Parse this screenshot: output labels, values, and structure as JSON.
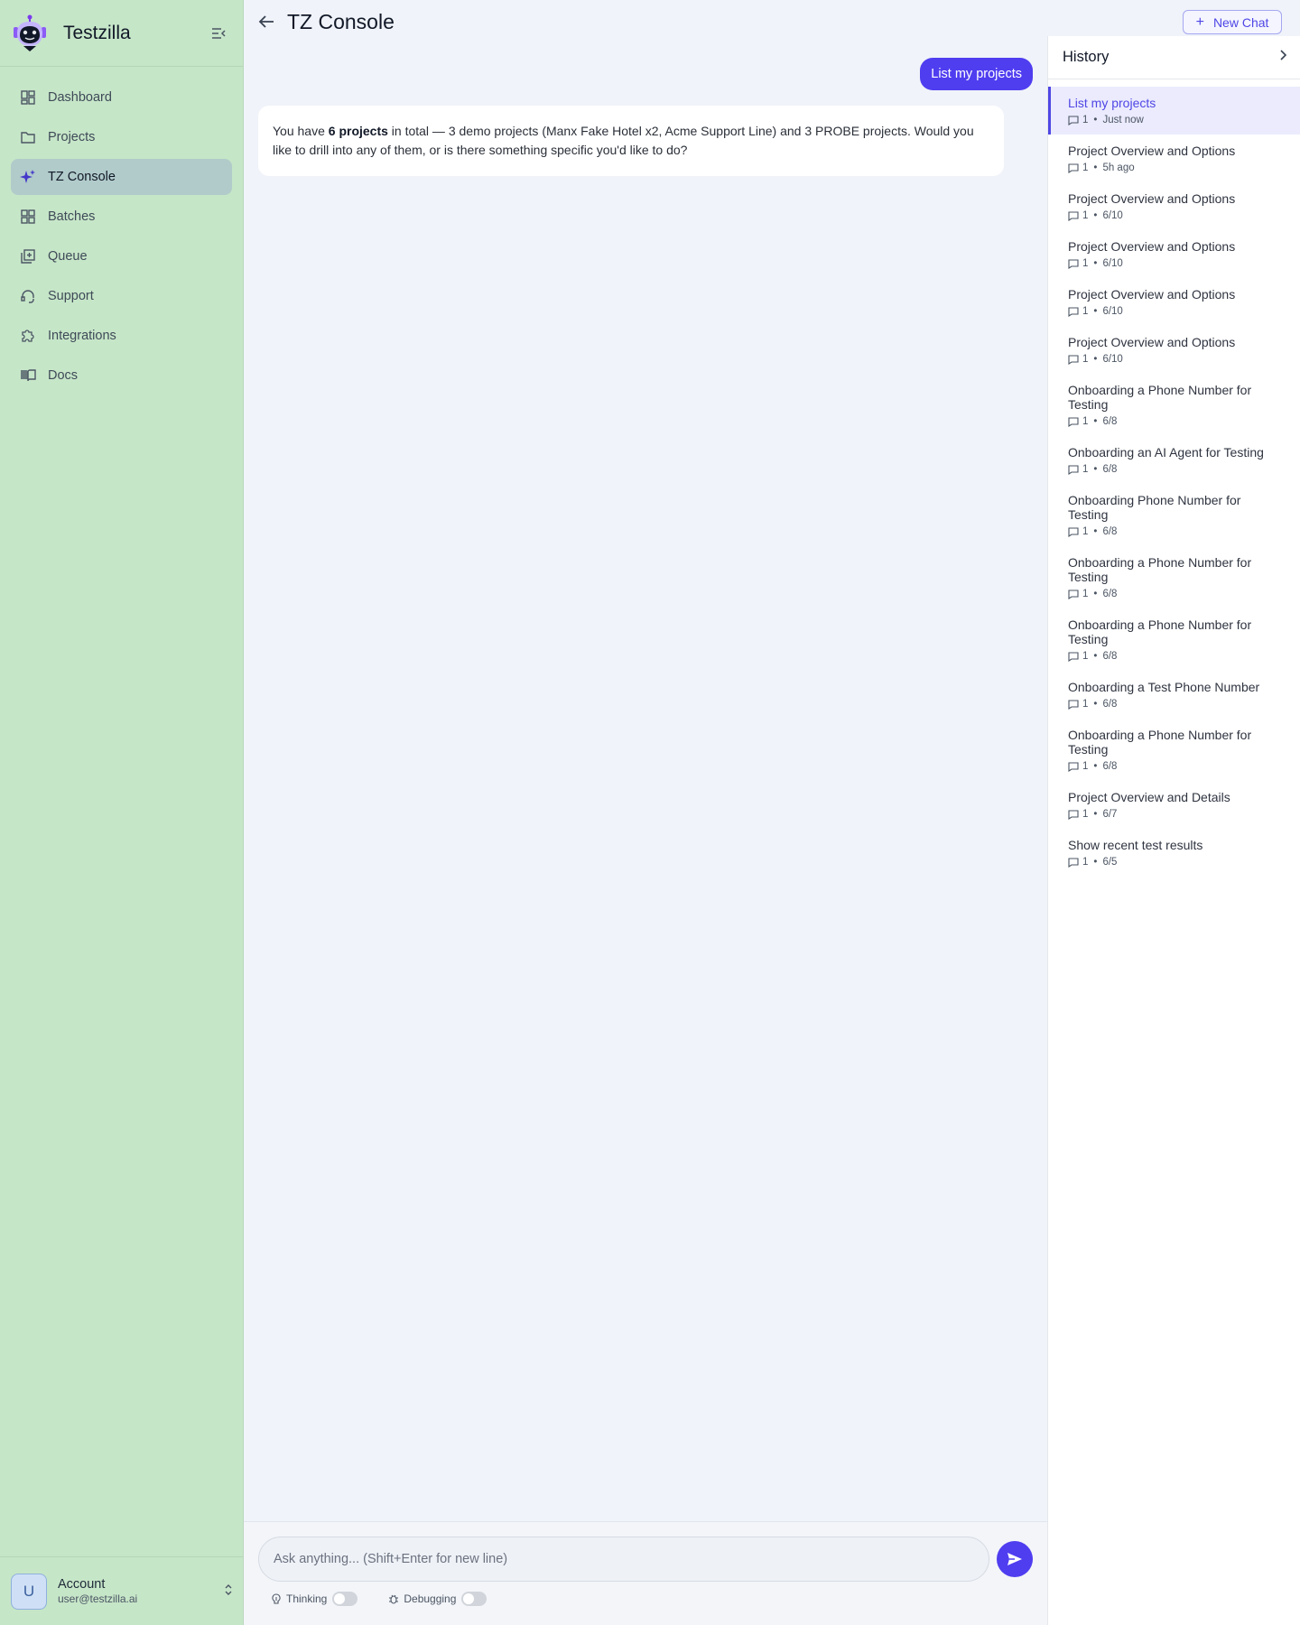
{
  "sidebar": {
    "brand": "Testzilla",
    "items": [
      {
        "label": "Dashboard",
        "icon": "dashboard-icon"
      },
      {
        "label": "Projects",
        "icon": "folder-icon"
      },
      {
        "label": "TZ Console",
        "icon": "sparkle-icon",
        "active": true
      },
      {
        "label": "Batches",
        "icon": "grid-icon"
      },
      {
        "label": "Queue",
        "icon": "queue-icon"
      },
      {
        "label": "Support",
        "icon": "headset-icon"
      },
      {
        "label": "Integrations",
        "icon": "puzzle-icon"
      },
      {
        "label": "Docs",
        "icon": "book-icon"
      }
    ],
    "account": {
      "initial": "U",
      "name": "Account",
      "email": "user@testzilla.ai"
    }
  },
  "header": {
    "title": "TZ Console"
  },
  "chat": {
    "user_message": "List my projects",
    "assistant": {
      "p1": "You have ",
      "b1": "6 projects",
      "p2": " in total — 3 demo projects (Manx Fake Hotel x2, Acme Support Line) and 3 PROBE projects. Would you like to drill into any of them, or is there something specific you'd like to do?"
    }
  },
  "composer": {
    "placeholder": "Ask anything... (Shift+Enter for new line)",
    "thinking_label": "Thinking",
    "debugging_label": "Debugging"
  },
  "history": {
    "new_chat_label": "New Chat",
    "title": "History",
    "items": [
      {
        "title": "List my projects",
        "count": "1",
        "time": "Just now",
        "active": true
      },
      {
        "title": "Project Overview and Options",
        "count": "1",
        "time": "5h ago"
      },
      {
        "title": "Project Overview and Options",
        "count": "1",
        "time": "6/10"
      },
      {
        "title": "Project Overview and Options",
        "count": "1",
        "time": "6/10"
      },
      {
        "title": "Project Overview and Options",
        "count": "1",
        "time": "6/10"
      },
      {
        "title": "Project Overview and Options",
        "count": "1",
        "time": "6/10"
      },
      {
        "title": "Onboarding a Phone Number for Testing",
        "count": "1",
        "time": "6/8"
      },
      {
        "title": "Onboarding an AI Agent for Testing",
        "count": "1",
        "time": "6/8"
      },
      {
        "title": "Onboarding Phone Number for Testing",
        "count": "1",
        "time": "6/8"
      },
      {
        "title": "Onboarding a Phone Number for Testing",
        "count": "1",
        "time": "6/8"
      },
      {
        "title": "Onboarding a Phone Number for Testing",
        "count": "1",
        "time": "6/8"
      },
      {
        "title": "Onboarding a Test Phone Number",
        "count": "1",
        "time": "6/8"
      },
      {
        "title": "Onboarding a Phone Number for Testing",
        "count": "1",
        "time": "6/8"
      },
      {
        "title": "Project Overview and Details",
        "count": "1",
        "time": "6/7"
      },
      {
        "title": "Show recent test results",
        "count": "1",
        "time": "6/5"
      }
    ]
  }
}
